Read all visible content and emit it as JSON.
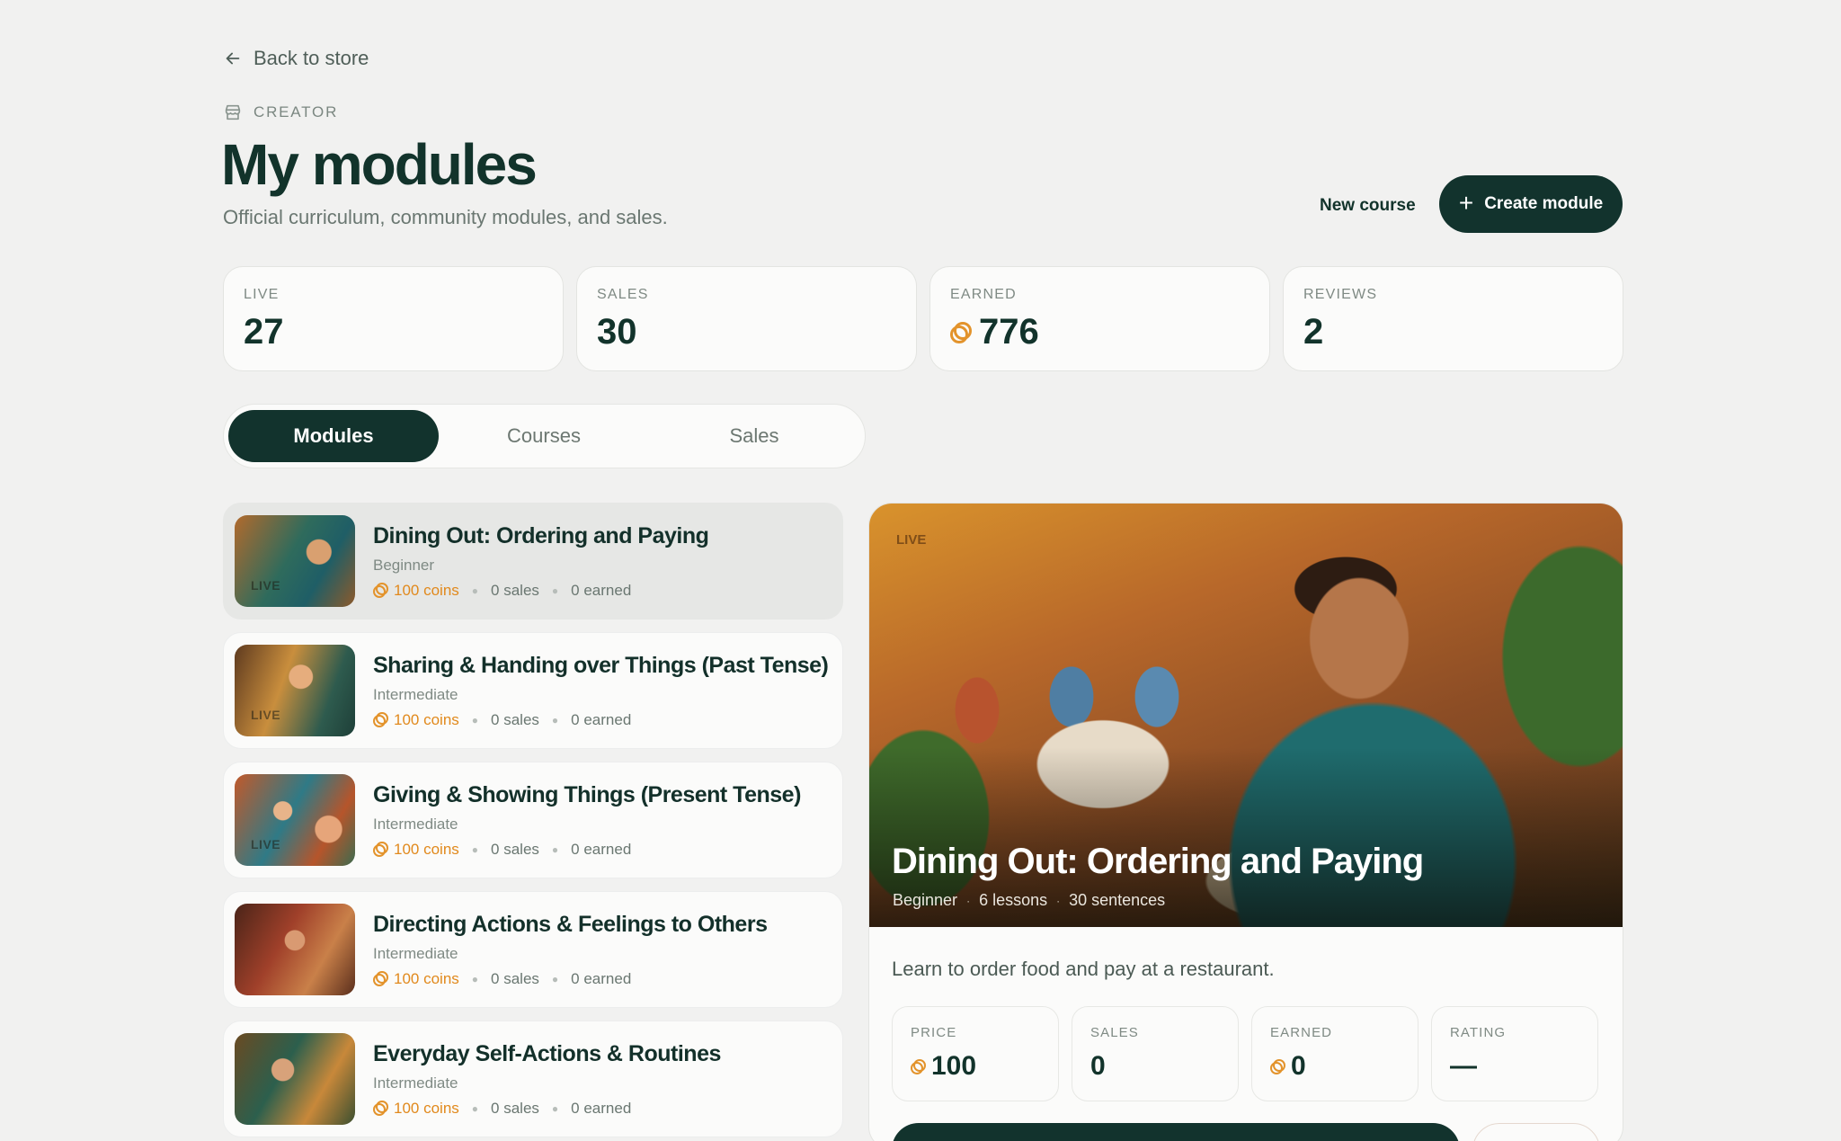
{
  "nav": {
    "back_label": "Back to store"
  },
  "header": {
    "eyebrow": "CREATOR",
    "title": "My modules",
    "subtitle": "Official curriculum, community modules, and sales.",
    "new_course_label": "New course",
    "create_module_label": "Create module"
  },
  "stats": [
    {
      "label": "LIVE",
      "value": "27"
    },
    {
      "label": "SALES",
      "value": "30"
    },
    {
      "label": "EARNED",
      "value": "776"
    },
    {
      "label": "REVIEWS",
      "value": "2"
    }
  ],
  "tabs": [
    {
      "label": "Modules",
      "active": true
    },
    {
      "label": "Courses",
      "active": false
    },
    {
      "label": "Sales",
      "active": false
    }
  ],
  "modules": [
    {
      "title": "Dining Out: Ordering and Paying",
      "level": "Beginner",
      "price": "100 coins",
      "sales": "0 sales",
      "earned": "0 earned",
      "badge": "LIVE"
    },
    {
      "title": "Sharing & Handing over Things (Past Tense)",
      "level": "Intermediate",
      "price": "100 coins",
      "sales": "0 sales",
      "earned": "0 earned",
      "badge": "LIVE"
    },
    {
      "title": "Giving & Showing Things (Present Tense)",
      "level": "Intermediate",
      "price": "100 coins",
      "sales": "0 sales",
      "earned": "0 earned",
      "badge": "LIVE"
    },
    {
      "title": "Directing Actions & Feelings to Others",
      "level": "Intermediate",
      "price": "100 coins",
      "sales": "0 sales",
      "earned": "0 earned",
      "badge": ""
    },
    {
      "title": "Everyday Self-Actions & Routines",
      "level": "Intermediate",
      "price": "100 coins",
      "sales": "0 sales",
      "earned": "0 earned",
      "badge": ""
    }
  ],
  "detail": {
    "badge": "LIVE",
    "title": "Dining Out: Ordering and Paying",
    "level": "Beginner",
    "lessons": "6 lessons",
    "sentences": "30 sentences",
    "description": "Learn to order food and pay at a restaurant.",
    "stats": [
      {
        "label": "PRICE",
        "value": "100"
      },
      {
        "label": "SALES",
        "value": "0"
      },
      {
        "label": "EARNED",
        "value": "0"
      },
      {
        "label": "RATING",
        "value": "—"
      }
    ]
  },
  "colors": {
    "primary": "#12332d",
    "coin": "#e1891c",
    "background": "#f1f1f0"
  }
}
